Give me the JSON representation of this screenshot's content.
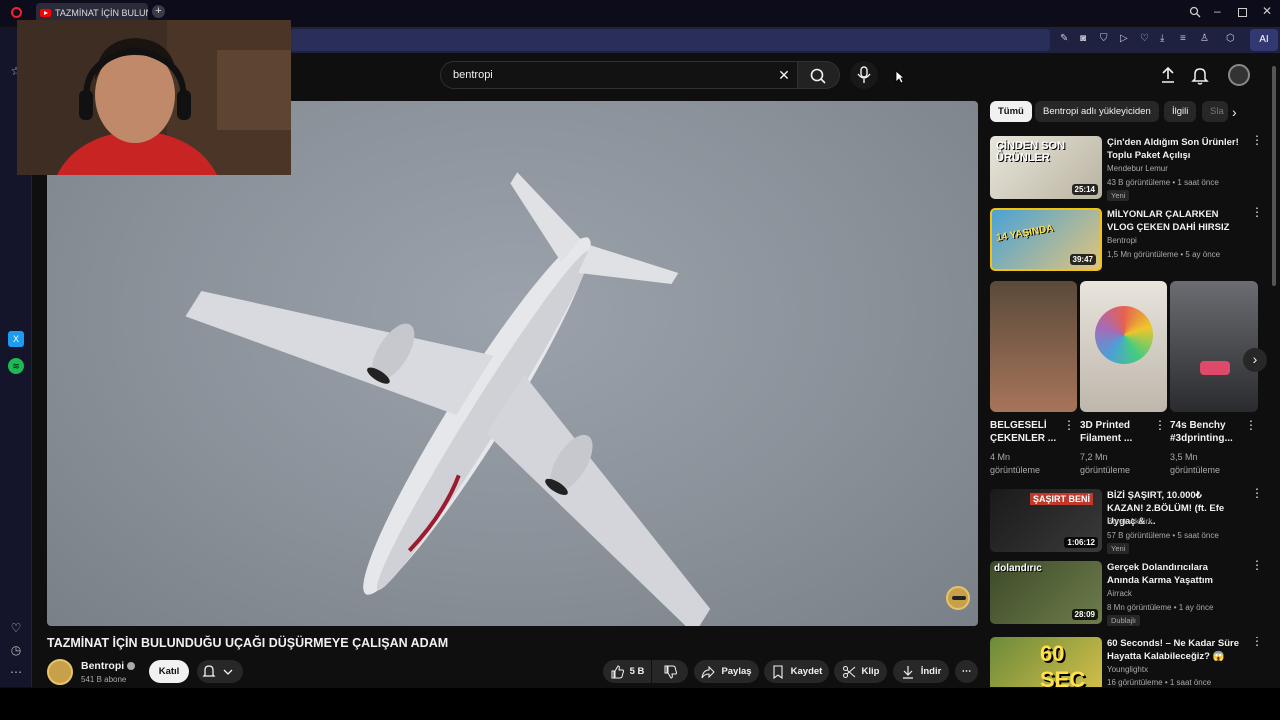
{
  "browser": {
    "tab_title": "TAZMİNAT İÇİN BULUNDU",
    "new_tab": "+",
    "ai_label": "AI"
  },
  "search": {
    "query": "bentropi"
  },
  "player": {
    "watermark_icon": "channel-logo"
  },
  "video": {
    "title": "TAZMİNAT İÇİN BULUNDUĞU UÇAĞI DÜŞÜRMEYE ÇALIŞAN ADAM",
    "channel": "Bentropi",
    "subscribers": "541 B abone",
    "join_label": "Katıl",
    "actions": {
      "likes": "5 B",
      "share": "Paylaş",
      "save": "Kaydet",
      "clip": "Klip",
      "download": "İndir"
    }
  },
  "filters": [
    "Tümü",
    "Bentropi adlı yükleyiciden",
    "İlgili",
    "Sla"
  ],
  "recommendations": [
    {
      "title": "Çin'den Aldığım Son Ürünler! Toplu Paket Açılışı",
      "channel": "Mendebur Lemur",
      "meta": "43 B görüntüleme • 1 saat önce",
      "duration": "25:14",
      "badge": "Yeni",
      "thumb_text": "ÇİNDEN SON ÜRÜNLER"
    },
    {
      "title": "MİLYONLAR ÇALARKEN VLOG ÇEKEN DAHİ HIRSIZ",
      "channel": "Bentropi",
      "meta": "1,5 Mn görüntüleme • 5 ay önce",
      "duration": "39:47",
      "thumb_text": "14 YAŞINDA"
    },
    {
      "title": "BİZİ ŞAŞIRT, 10.000₺ KAZAN! 2.BÖLÜM! (ft. Efe Uygaç & ...",
      "channel": "Burak Aktürk",
      "meta": "57 B görüntüleme • 5 saat önce",
      "duration": "1:06:12",
      "badge": "Yeni",
      "thumb_text": "ŞAŞIRT BENİ"
    },
    {
      "title": "Gerçek Dolandırıcılara Anında Karma Yaşattım",
      "channel": "Airrack",
      "meta": "8 Mn görüntüleme • 1 ay önce",
      "duration": "28:09",
      "badge": "Dublajlı",
      "thumb_text": "dolandırıc"
    },
    {
      "title": "60 Seconds! – Ne Kadar Süre Hayatta Kalabileceğiz? 😱",
      "channel": "Younglightx",
      "meta": "16 görüntüleme • 1 saat önce",
      "thumb_text": "60 SEC"
    }
  ],
  "shorts": [
    {
      "title": "BELGESELİ ÇEKENLER ...",
      "views": "4 Mn görüntüleme"
    },
    {
      "title": "3D Printed Filament ...",
      "views": "7,2 Mn görüntüleme"
    },
    {
      "title": "74s Benchy #3dprinting...",
      "views": "3,5 Mn görüntüleme"
    }
  ],
  "colors": {
    "background": "#0f0f0f",
    "chip_active": "#f1f1f1",
    "secondary_text": "#aaaaaa",
    "youtube_red": "#ff0000"
  }
}
